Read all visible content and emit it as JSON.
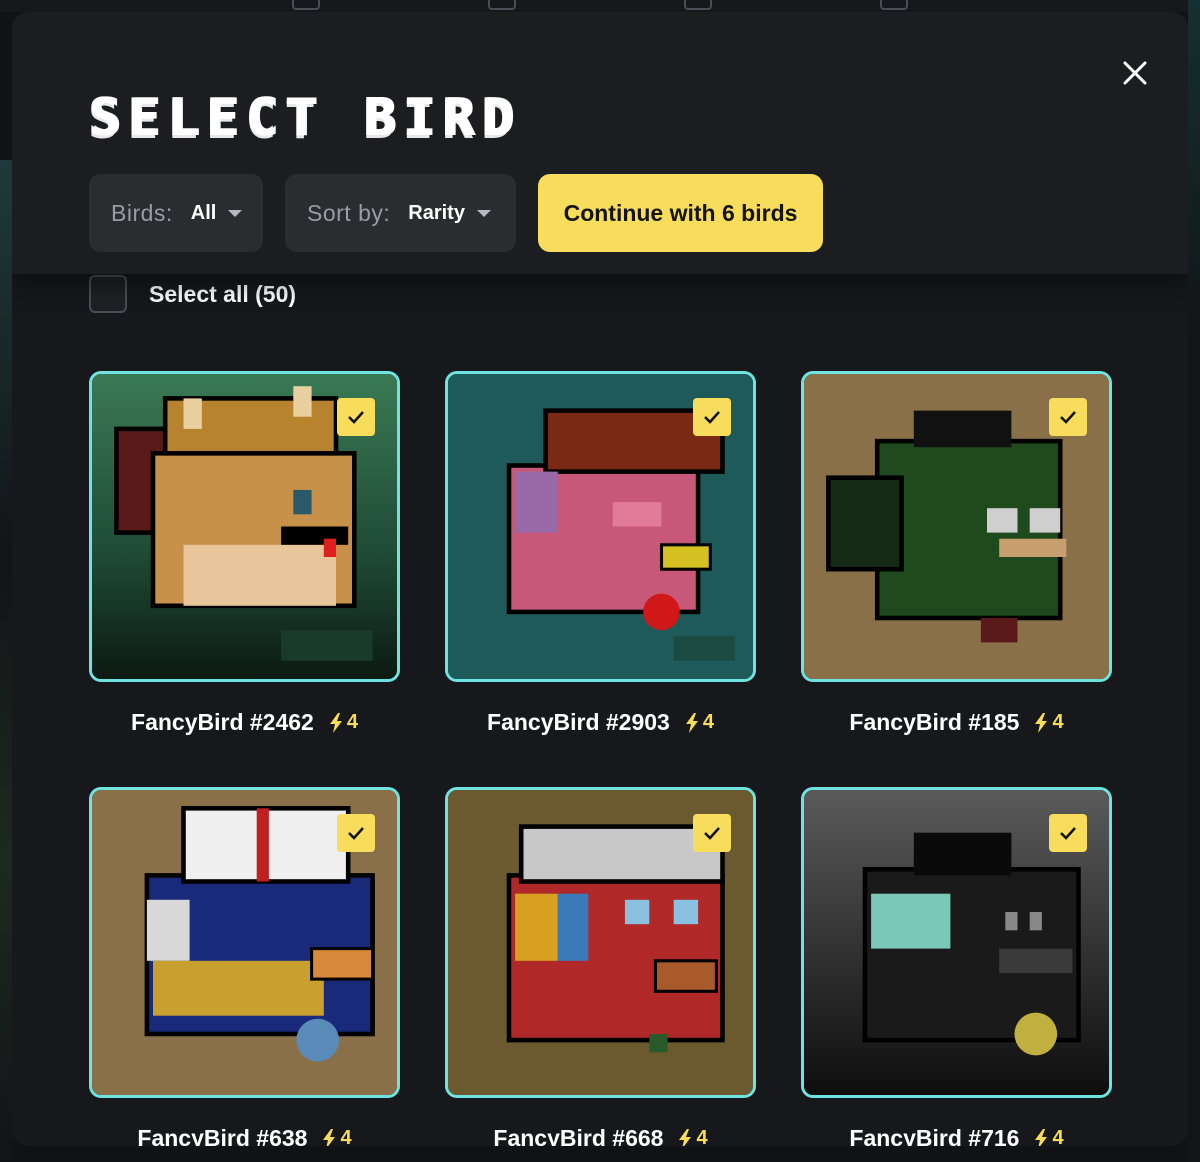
{
  "modal": {
    "title": "SELECT BIRD",
    "close_icon": "close-icon"
  },
  "filters": {
    "birds_label": "Birds:",
    "birds_value": "All",
    "sort_label": "Sort by:",
    "sort_value": "Rarity"
  },
  "continue_label": "Continue with 6 birds",
  "select_all_label": "Select all (50)",
  "colors": {
    "accent_yellow": "#f7dd5b",
    "card_border": "#6fe3df",
    "modal_bg": "#17181b"
  },
  "birds": [
    {
      "name": "FancyBird #2462",
      "power": "4",
      "selected": true,
      "bg": "#2d5a3f"
    },
    {
      "name": "FancyBird #2903",
      "power": "4",
      "selected": true,
      "bg": "#1e5a5a"
    },
    {
      "name": "FancyBird #185",
      "power": "4",
      "selected": true,
      "bg": "#7a6440"
    },
    {
      "name": "FancyBird #638",
      "power": "4",
      "selected": true,
      "bg": "#7a6440"
    },
    {
      "name": "FancyBird #668",
      "power": "4",
      "selected": true,
      "bg": "#6b5a30"
    },
    {
      "name": "FancyBird #716",
      "power": "4",
      "selected": true,
      "bg": "#3a3a3a"
    }
  ]
}
